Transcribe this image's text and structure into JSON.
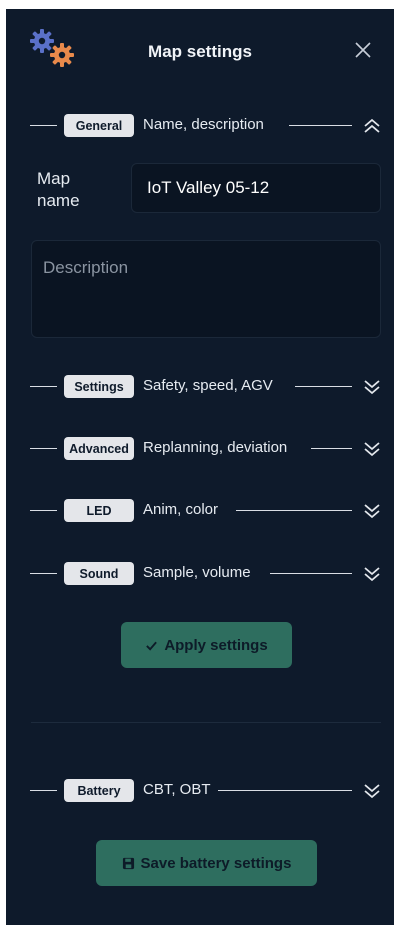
{
  "header": {
    "title": "Map settings"
  },
  "general": {
    "badge": "General",
    "subtitle": "Name, description"
  },
  "map_name": {
    "label": "Map name",
    "value": "IoT Valley 05-12"
  },
  "description": {
    "placeholder": "Description"
  },
  "sections": [
    {
      "badge": "Settings",
      "subtitle": "Safety, speed, AGV"
    },
    {
      "badge": "Advanced",
      "subtitle": "Replanning, deviation"
    },
    {
      "badge": "LED",
      "subtitle": "Anim, color"
    },
    {
      "badge": "Sound",
      "subtitle": "Sample, volume"
    }
  ],
  "apply_button": {
    "label": "Apply settings",
    "icon": "check-icon"
  },
  "battery": {
    "badge": "Battery",
    "subtitle": "CBT, OBT"
  },
  "save_battery_button": {
    "label": "Save battery settings",
    "icon": "floppy-disk-icon"
  },
  "colors": {
    "panel_bg": "#0e1a2b",
    "badge_bg": "#e4e6ea",
    "button_bg": "#2e6e5f",
    "gear_primary": "#5a70c8",
    "gear_accent": "#e98a4b"
  }
}
